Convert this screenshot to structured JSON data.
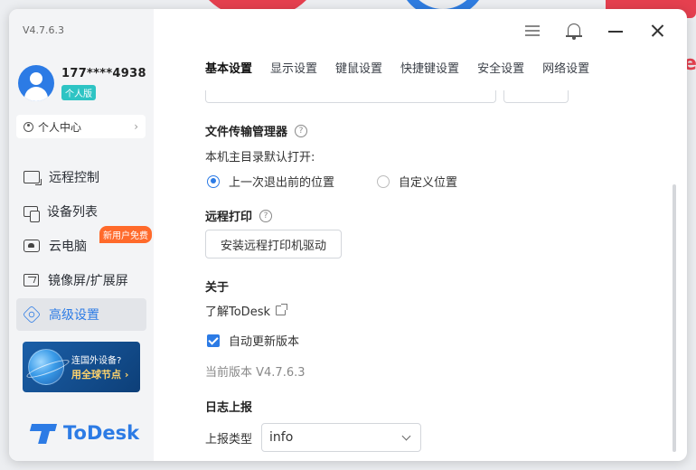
{
  "background": {
    "peek_letter": "e"
  },
  "app": {
    "version": "V4.7.6.3"
  },
  "user": {
    "name": "177****4938",
    "badge": "个人版"
  },
  "sidebar": {
    "personal_center": "个人中心",
    "items": [
      {
        "label": "远程控制",
        "icon": "remote-control-icon"
      },
      {
        "label": "设备列表",
        "icon": "devices-icon"
      },
      {
        "label": "云电脑",
        "icon": "cloud-pc-icon",
        "badge": "新用户免费"
      },
      {
        "label": "镜像屏/扩展屏",
        "icon": "mirror-screen-icon"
      },
      {
        "label": "高级设置",
        "icon": "advanced-settings-icon",
        "active": true
      }
    ],
    "promo": {
      "line1": "连国外设备?",
      "line2": "用全球节点 ›"
    },
    "logo_text": "ToDesk"
  },
  "tabs": [
    {
      "label": "基本设置",
      "active": true
    },
    {
      "label": "显示设置"
    },
    {
      "label": "键鼠设置"
    },
    {
      "label": "快捷键设置"
    },
    {
      "label": "安全设置"
    },
    {
      "label": "网络设置"
    }
  ],
  "file_transfer": {
    "title": "文件传输管理器",
    "default_open_label": "本机主目录默认打开:",
    "options": [
      "上一次退出前的位置",
      "自定义位置"
    ],
    "selected": 0
  },
  "remote_print": {
    "title": "远程打印",
    "button": "安装远程打印机驱动"
  },
  "about": {
    "title": "关于",
    "learn_more": "了解ToDesk",
    "auto_update_label": "自动更新版本",
    "auto_update_checked": true,
    "current_version": "当前版本 V4.7.6.3"
  },
  "log_report": {
    "title": "日志上报",
    "type_label": "上报类型",
    "type_value": "info"
  },
  "colors": {
    "accent": "#2c7be5",
    "badge_orange": "#ff6a2b",
    "badge_teal": "#2ec4c4"
  }
}
